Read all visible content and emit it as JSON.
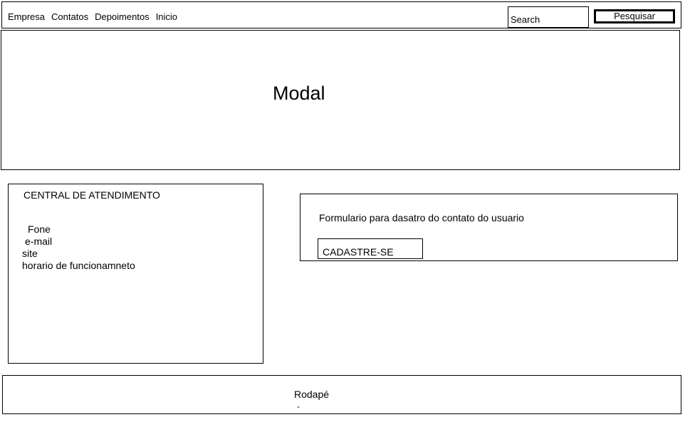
{
  "nav": {
    "items": [
      "Empresa",
      "Contatos",
      "Depoimentos",
      "Inicio"
    ],
    "search_placeholder": "Search",
    "search_button": "Pesquisar"
  },
  "modal": {
    "title": "Modal"
  },
  "central": {
    "title": "CENTRAL DE ATENDIMENTO",
    "lines": [
      "Fone",
      "e-mail",
      "site",
      "horario de funcionamneto"
    ]
  },
  "form": {
    "text": "Formulario para dasatro do contato do usuario",
    "button": "CADASTRE-SE"
  },
  "footer": {
    "title": "Rodapé",
    "mark": "-"
  }
}
